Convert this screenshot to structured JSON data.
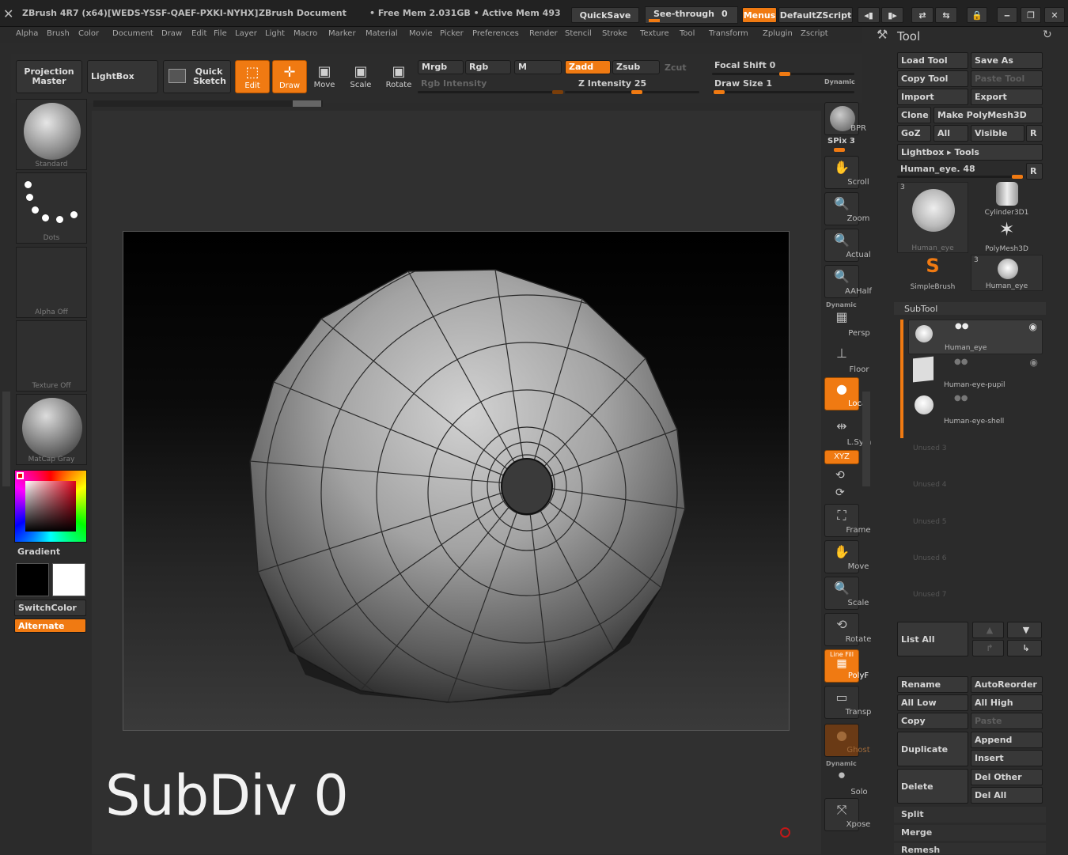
{
  "titlebar": {
    "app": "ZBrush 4R7 (x64)[WEDS-YSSF-QAEF-PXKI-NYHX]",
    "document": "ZBrush Document",
    "free_mem": "• Free Mem 2.031GB • Active Mem 493",
    "quicksave": "QuickSave",
    "see_through": "See-through",
    "see_through_value": "0",
    "menus": "Menus",
    "default_zscript": "DefaultZScript"
  },
  "menubar": [
    "Alpha",
    "Brush",
    "Color",
    "Document",
    "Draw",
    "Edit",
    "File",
    "Layer",
    "Light",
    "Macro",
    "Marker",
    "Material",
    "Movie",
    "Picker",
    "Preferences",
    "Render",
    "Stencil",
    "Stroke",
    "Texture",
    "Tool",
    "Transform",
    "Zplugin",
    "Zscript"
  ],
  "topshelf": {
    "projection_master": "Projection Master",
    "lightbox": "LightBox",
    "quick_sketch": "Quick Sketch",
    "edit": "Edit",
    "draw": "Draw",
    "move": "Move",
    "scale": "Scale",
    "rotate": "Rotate",
    "mrgb": "Mrgb",
    "rgb": "Rgb",
    "m": "M",
    "zadd": "Zadd",
    "zsub": "Zsub",
    "zcut": "Zcut",
    "rgb_intensity": "Rgb Intensity",
    "z_intensity": "Z Intensity 25",
    "focal_shift": "Focal Shift 0",
    "draw_size": "Draw Size 1",
    "dynamic": "Dynamic"
  },
  "leftpanel": {
    "brush": "Standard",
    "stroke": "Dots",
    "alpha": "Alpha Off",
    "texture": "Texture Off",
    "material": "MatCap Gray",
    "gradient": "Gradient",
    "switch_color": "SwitchColor",
    "alternate": "Alternate"
  },
  "canvas": {
    "overlay_text": "SubDiv 0"
  },
  "rightshelf": {
    "bpr": "BPR",
    "spix": "SPix 3",
    "scroll": "Scroll",
    "zoom": "Zoom",
    "actual": "Actual",
    "aahalf": "AAHalf",
    "dynamic": "Dynamic",
    "persp": "Persp",
    "floor": "Floor",
    "local": "Local",
    "lsym": "L.Sym",
    "xyz": "XYZ",
    "frame": "Frame",
    "move": "Move",
    "scale": "Scale",
    "rotate": "Rotate",
    "line_fill": "Line Fill",
    "polyf": "PolyF",
    "transp": "Transp",
    "ghost": "Ghost",
    "dynamic2": "Dynamic",
    "solo": "Solo",
    "xpose": "Xpose"
  },
  "toolpanel": {
    "title": "Tool",
    "load_tool": "Load Tool",
    "save_as": "Save As",
    "copy_tool": "Copy Tool",
    "paste_tool": "Paste Tool",
    "import": "Import",
    "export": "Export",
    "clone": "Clone",
    "make_polymesh": "Make PolyMesh3D",
    "goz": "GoZ",
    "all": "All",
    "visible": "Visible",
    "r": "R",
    "lightbox_tools": "Lightbox ▸ Tools",
    "current_tool": "Human_eye. 48",
    "thumbs": [
      {
        "name": "Human_eye",
        "count": "3"
      },
      {
        "name": "Cylinder3D1"
      },
      {
        "name": "PolyMesh3D"
      },
      {
        "name": "SimpleBrush"
      },
      {
        "name": "Human_eye",
        "count": "3"
      }
    ],
    "subtool_header": "SubTool",
    "subtools": [
      "Human_eye",
      "Human-eye-pupil",
      "Human-eye-shell"
    ],
    "unused": [
      "Unused 3",
      "Unused 4",
      "Unused 5",
      "Unused 6",
      "Unused 7"
    ],
    "list_all": "List All",
    "rename": "Rename",
    "autoreorder": "AutoReorder",
    "all_low": "All Low",
    "all_high": "All High",
    "copy": "Copy",
    "paste": "Paste",
    "duplicate": "Duplicate",
    "append": "Append",
    "insert": "Insert",
    "delete": "Delete",
    "del_other": "Del Other",
    "del_all": "Del All",
    "split": "Split",
    "merge": "Merge",
    "remesh": "Remesh"
  },
  "colors": {
    "accent": "#f07a12",
    "panel": "#2b2b2b",
    "button": "#383838"
  }
}
